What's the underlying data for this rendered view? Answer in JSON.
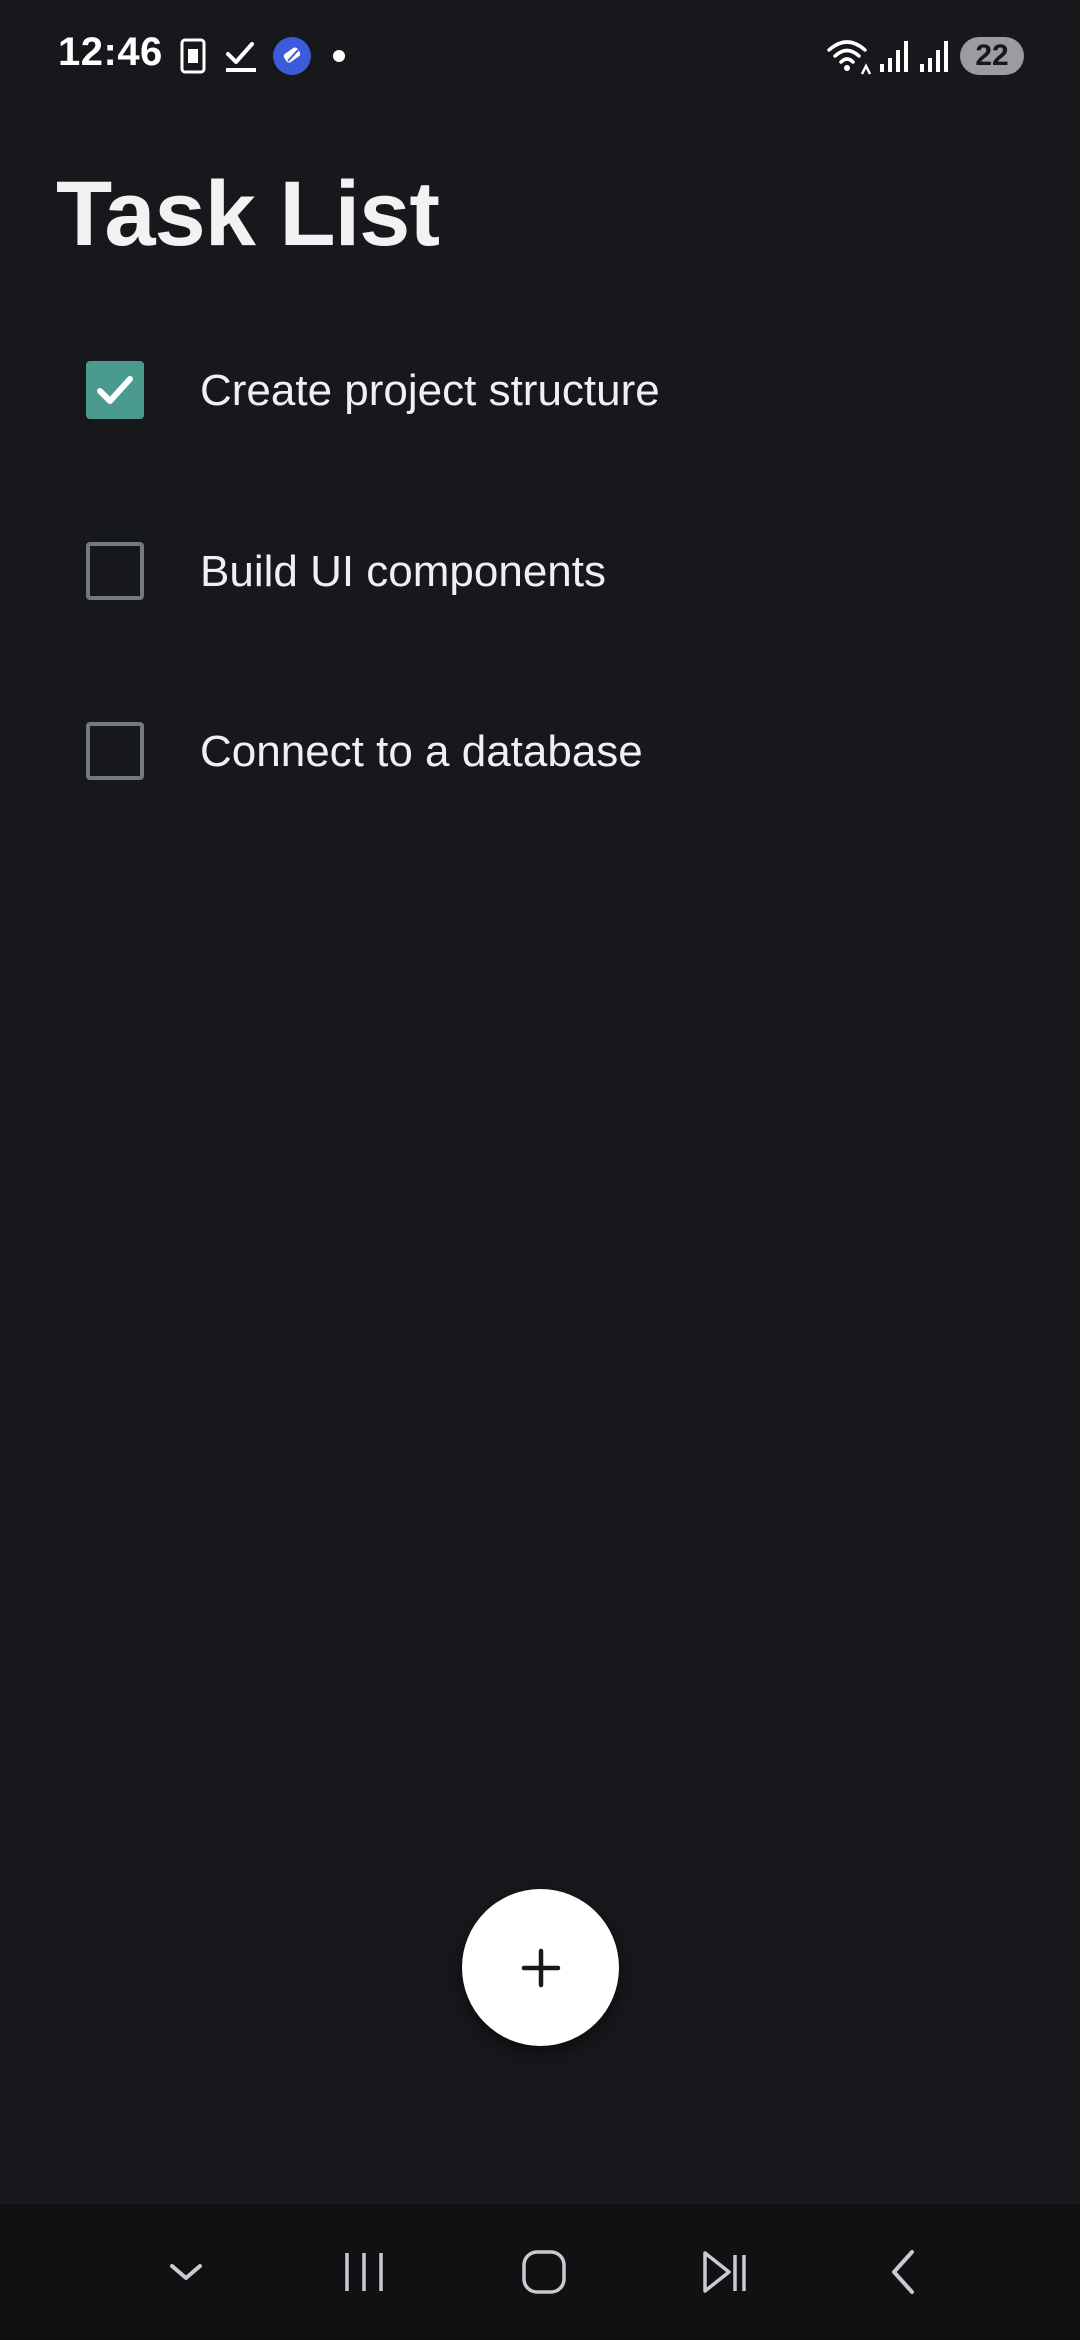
{
  "status_bar": {
    "time": "12:46",
    "battery": "22",
    "left_icons": [
      "sim-card-icon",
      "task-check-icon",
      "app-badge-icon",
      "notification-dot-icon"
    ],
    "right_icons": [
      "wifi-icon",
      "signal-icon",
      "signal-icon"
    ]
  },
  "header": {
    "title": "Task List"
  },
  "tasks": [
    {
      "label": "Create project structure",
      "checked": true
    },
    {
      "label": "Build UI components",
      "checked": false
    },
    {
      "label": "Connect to a database",
      "checked": false
    }
  ],
  "fab": {
    "icon": "plus-icon"
  },
  "nav_bar": {
    "buttons": [
      "hide-keyboard-icon",
      "recent-apps-icon",
      "home-icon",
      "media-icon",
      "back-icon"
    ]
  },
  "colors": {
    "background": "#17181b",
    "checkbox_checked": "#4a9a8e",
    "checkbox_border": "#737a83",
    "fab": "#ffffff",
    "nav_bar": "#101113"
  }
}
